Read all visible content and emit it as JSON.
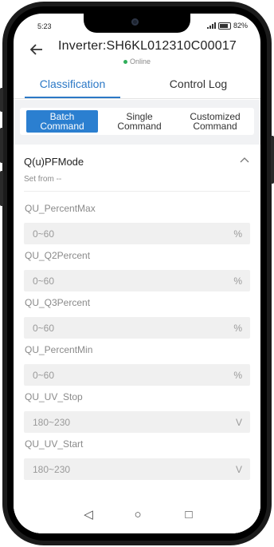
{
  "status_bar": {
    "time": "5:23",
    "battery": "82%"
  },
  "header": {
    "back_icon": "arrow-left-icon",
    "title": "Inverter:SH6KL012310C00017",
    "status_text": "Online",
    "status_color": "#2fae5a"
  },
  "tabs": [
    {
      "label": "Classification",
      "active": true
    },
    {
      "label": "Control Log",
      "active": false
    }
  ],
  "segmented": [
    {
      "label_line1": "Batch",
      "label_line2": "Command",
      "active": true
    },
    {
      "label_line1": "Single",
      "label_line2": "Command",
      "active": false
    },
    {
      "label_line1": "Customized",
      "label_line2": "Command",
      "active": false
    }
  ],
  "card": {
    "title": "Q(u)PFMode",
    "set_from": "Set from --",
    "collapse_icon": "chevron-up-icon",
    "params": [
      {
        "label": "QU_PercentMax",
        "placeholder": "0~60",
        "unit": "%"
      },
      {
        "label": "QU_Q2Percent",
        "placeholder": "0~60",
        "unit": "%"
      },
      {
        "label": "QU_Q3Percent",
        "placeholder": "0~60",
        "unit": "%"
      },
      {
        "label": "QU_PercentMin",
        "placeholder": "0~60",
        "unit": "%"
      },
      {
        "label": "QU_UV_Stop",
        "placeholder": "180~230",
        "unit": "V"
      },
      {
        "label": "QU_UV_Start",
        "placeholder": "180~230",
        "unit": "V"
      }
    ]
  },
  "nav": {
    "back": "◁",
    "home": "○",
    "recents": "□"
  },
  "colors": {
    "accent": "#2b78c6",
    "segment_active": "#2b7fd0"
  }
}
